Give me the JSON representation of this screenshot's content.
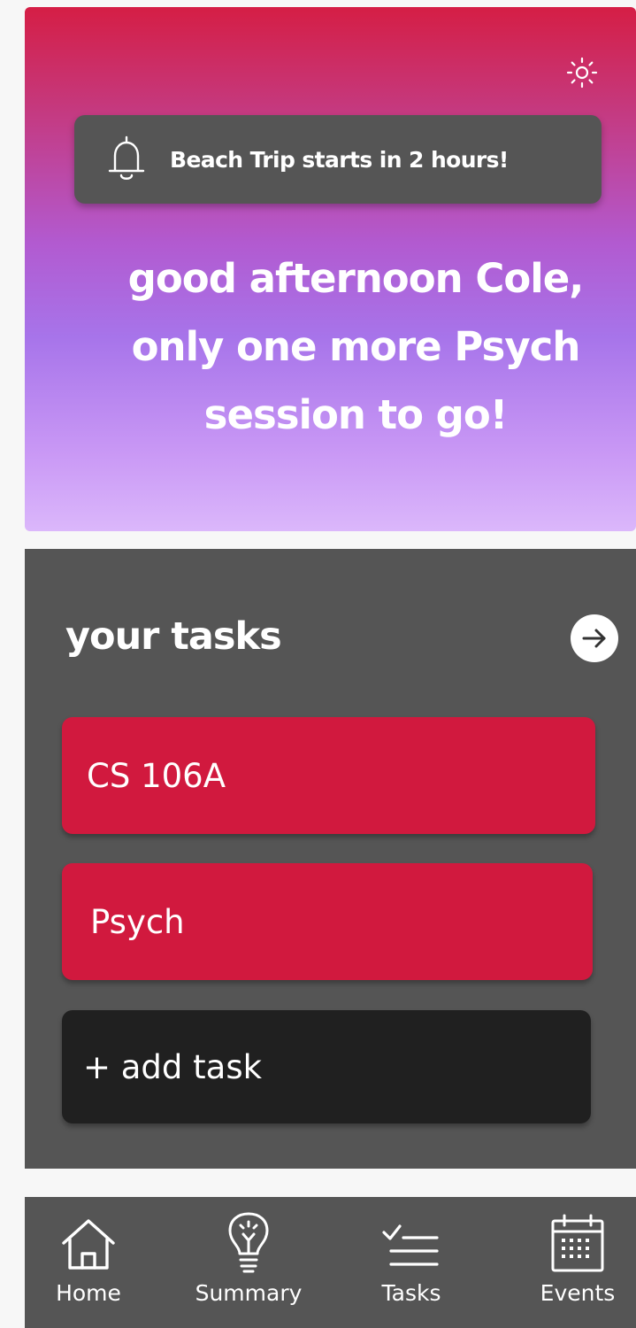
{
  "header": {
    "theme_icon": "sun-icon",
    "notification": {
      "icon": "bell-icon",
      "text": "Beach Trip starts in 2 hours!"
    },
    "greeting_lines": [
      "good afternoon Cole,",
      "only one more Psych",
      "session to go!"
    ],
    "gradient_colors": [
      "#d51e45",
      "#b25ad0",
      "#a774ea",
      "#dbb7fb"
    ]
  },
  "tasks": {
    "title": "your tasks",
    "open_icon": "arrow-right-circle-icon",
    "items": [
      {
        "label": "CS 106A",
        "color": "#d1193e"
      },
      {
        "label": "Psych",
        "color": "#d1193e"
      }
    ],
    "add_label": "+ add task"
  },
  "nav": {
    "items": [
      {
        "label": "Home",
        "icon": "home-icon"
      },
      {
        "label": "Summary",
        "icon": "lightbulb-icon"
      },
      {
        "label": "Tasks",
        "icon": "checklist-icon"
      },
      {
        "label": "Events",
        "icon": "calendar-icon"
      }
    ]
  },
  "colors": {
    "panel": "#555555",
    "card_dark": "#202020",
    "accent": "#d1193e"
  }
}
